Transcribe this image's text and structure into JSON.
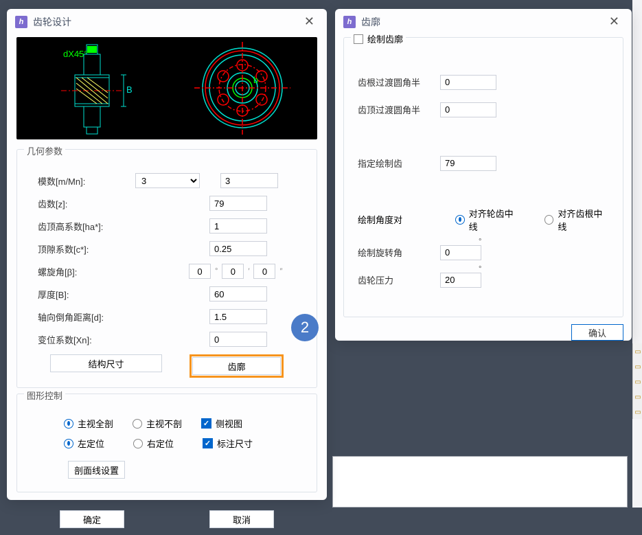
{
  "dialog1": {
    "title": "齿轮设计",
    "geom_section": "几何参数",
    "modulus_label": "模数[m/Mn]:",
    "modulus_combo": "3",
    "modulus_val": "3",
    "teeth_label": "齿数[z]:",
    "teeth_val": "79",
    "addendum_label": "齿顶高系数[ha*]:",
    "addendum_val": "1",
    "clearance_label": "顶隙系数[c*]:",
    "clearance_val": "0.25",
    "helix_label": "螺旋角[β]:",
    "helix_d": "0",
    "helix_m": "0",
    "helix_s": "0",
    "thickness_label": "厚度[B]:",
    "thickness_val": "60",
    "chamfer_label": "轴向倒角距离[d]:",
    "chamfer_val": "1.5",
    "shift_label": "变位系数[Xn]:",
    "shift_val": "0",
    "struct_btn": "结构尺寸",
    "profile_btn": "齿廓",
    "graphic_section": "图形控制",
    "main_full": "主视全剖",
    "main_none": "主视不剖",
    "side_view": "侧视图",
    "left_pos": "左定位",
    "right_pos": "右定位",
    "dim_label": "标注尺寸",
    "hatch_btn": "剖面线设置",
    "ok": "确定",
    "cancel": "取消",
    "annotation": "2"
  },
  "dialog2": {
    "title": "齿廓",
    "draw_profile": "绘制齿廓",
    "root_fillet_label": "齿根过渡圆角半",
    "root_fillet_val": "0",
    "tip_fillet_label": "齿顶过渡圆角半",
    "tip_fillet_val": "0",
    "draw_teeth_label": "指定绘制齿",
    "draw_teeth_val": "79",
    "angle_align_label": "绘制角度对",
    "align_tooth_center": "对齐轮齿中线",
    "align_root_center": "对齐齿根中线",
    "rotation_label": "绘制旋转角",
    "rotation_val": "0",
    "pressure_label": "齿轮压力",
    "pressure_val": "20",
    "confirm": "确认"
  }
}
